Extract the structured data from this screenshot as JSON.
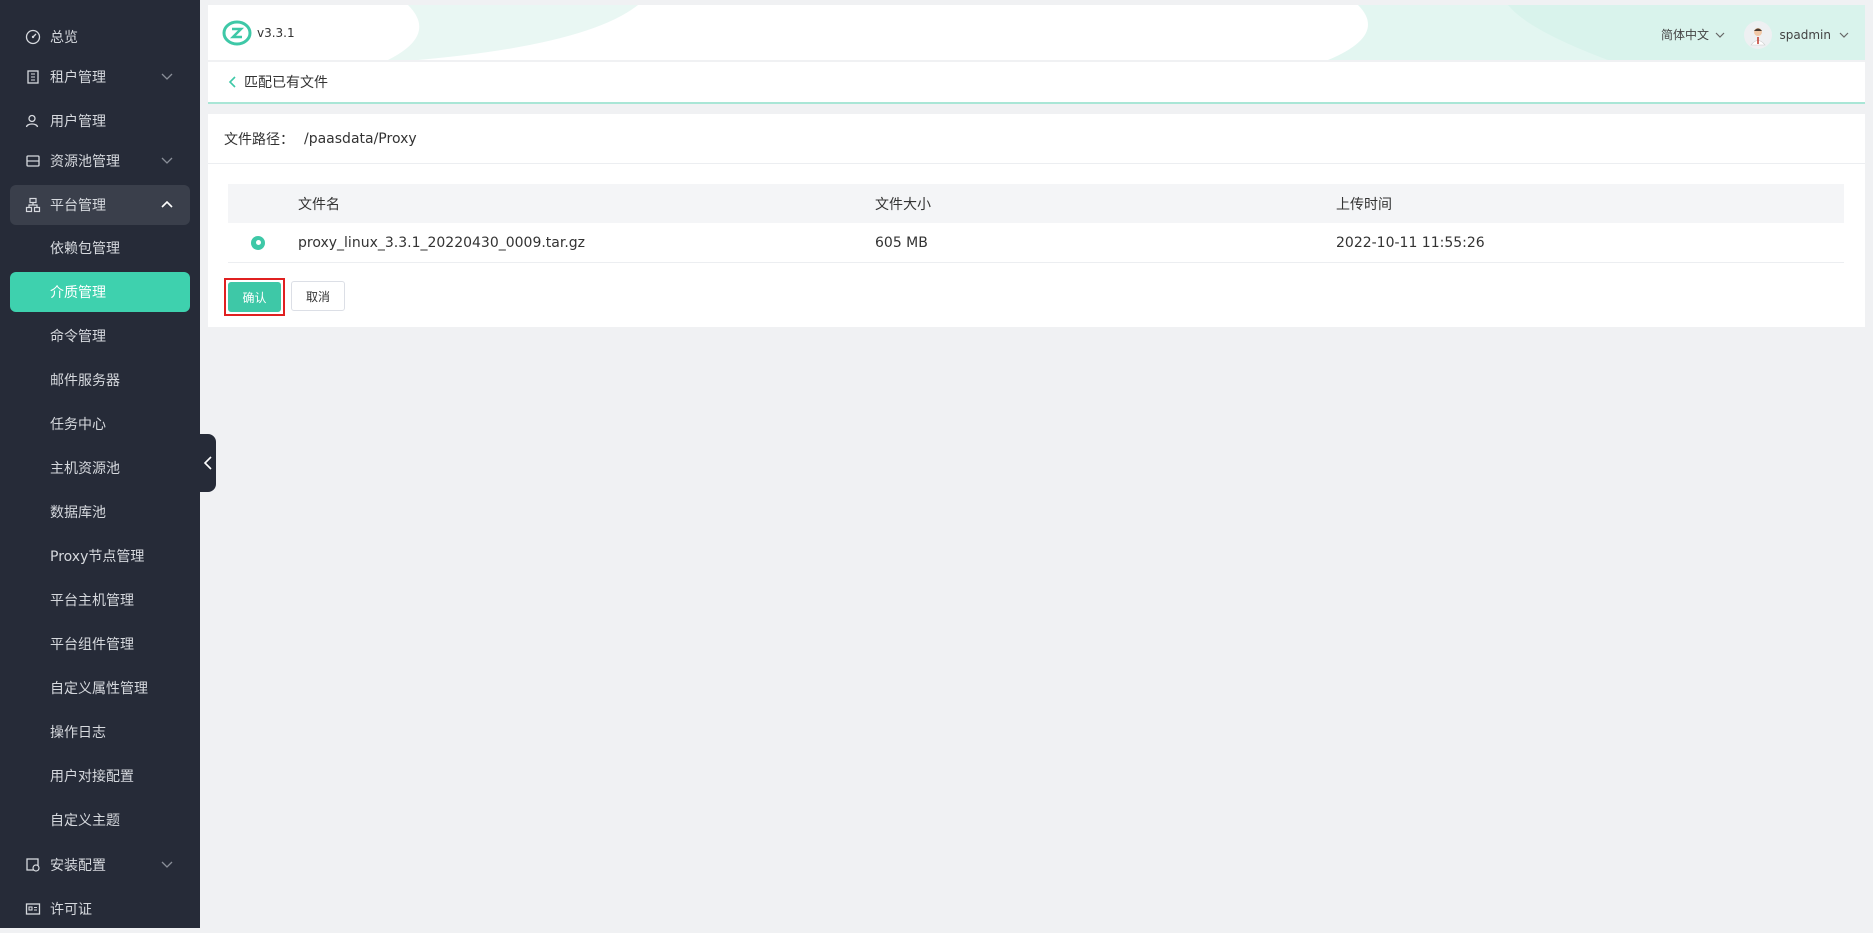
{
  "sidebar": {
    "items": [
      {
        "label": "总览",
        "icon": "dashboard-icon"
      },
      {
        "label": "租户管理",
        "icon": "building-icon"
      },
      {
        "label": "用户管理",
        "icon": "users-icon"
      },
      {
        "label": "资源池管理",
        "icon": "database-icon"
      },
      {
        "label": "平台管理",
        "icon": "platform-icon"
      },
      {
        "label": "安装配置",
        "icon": "install-icon"
      },
      {
        "label": "许可证",
        "icon": "license-icon"
      }
    ],
    "sub_items": [
      {
        "label": "依赖包管理"
      },
      {
        "label": "介质管理",
        "active": true
      },
      {
        "label": "命令管理"
      },
      {
        "label": "邮件服务器"
      },
      {
        "label": "任务中心"
      },
      {
        "label": "主机资源池"
      },
      {
        "label": "数据库池"
      },
      {
        "label": "Proxy节点管理"
      },
      {
        "label": "平台主机管理"
      },
      {
        "label": "平台组件管理"
      },
      {
        "label": "自定义属性管理"
      },
      {
        "label": "操作日志"
      },
      {
        "label": "用户对接配置"
      },
      {
        "label": "自定义主题"
      }
    ]
  },
  "header": {
    "version": "v3.3.1",
    "language": "简体中文",
    "username": "spadmin"
  },
  "page": {
    "title": "匹配已有文件",
    "path_label": "文件路径：",
    "path_value": "/paasdata/Proxy"
  },
  "table": {
    "columns": [
      "文件名",
      "文件大小",
      "上传时间"
    ],
    "rows": [
      {
        "name": "proxy_linux_3.3.1_20220430_0009.tar.gz",
        "size": "605 MB",
        "time": "2022-10-11 11:55:26",
        "selected": true
      }
    ]
  },
  "actions": {
    "confirm": "确认",
    "cancel": "取消"
  },
  "colors": {
    "accent": "#3ec8a7",
    "sidebar_bg": "#262b38",
    "highlight_border": "#e02020"
  }
}
